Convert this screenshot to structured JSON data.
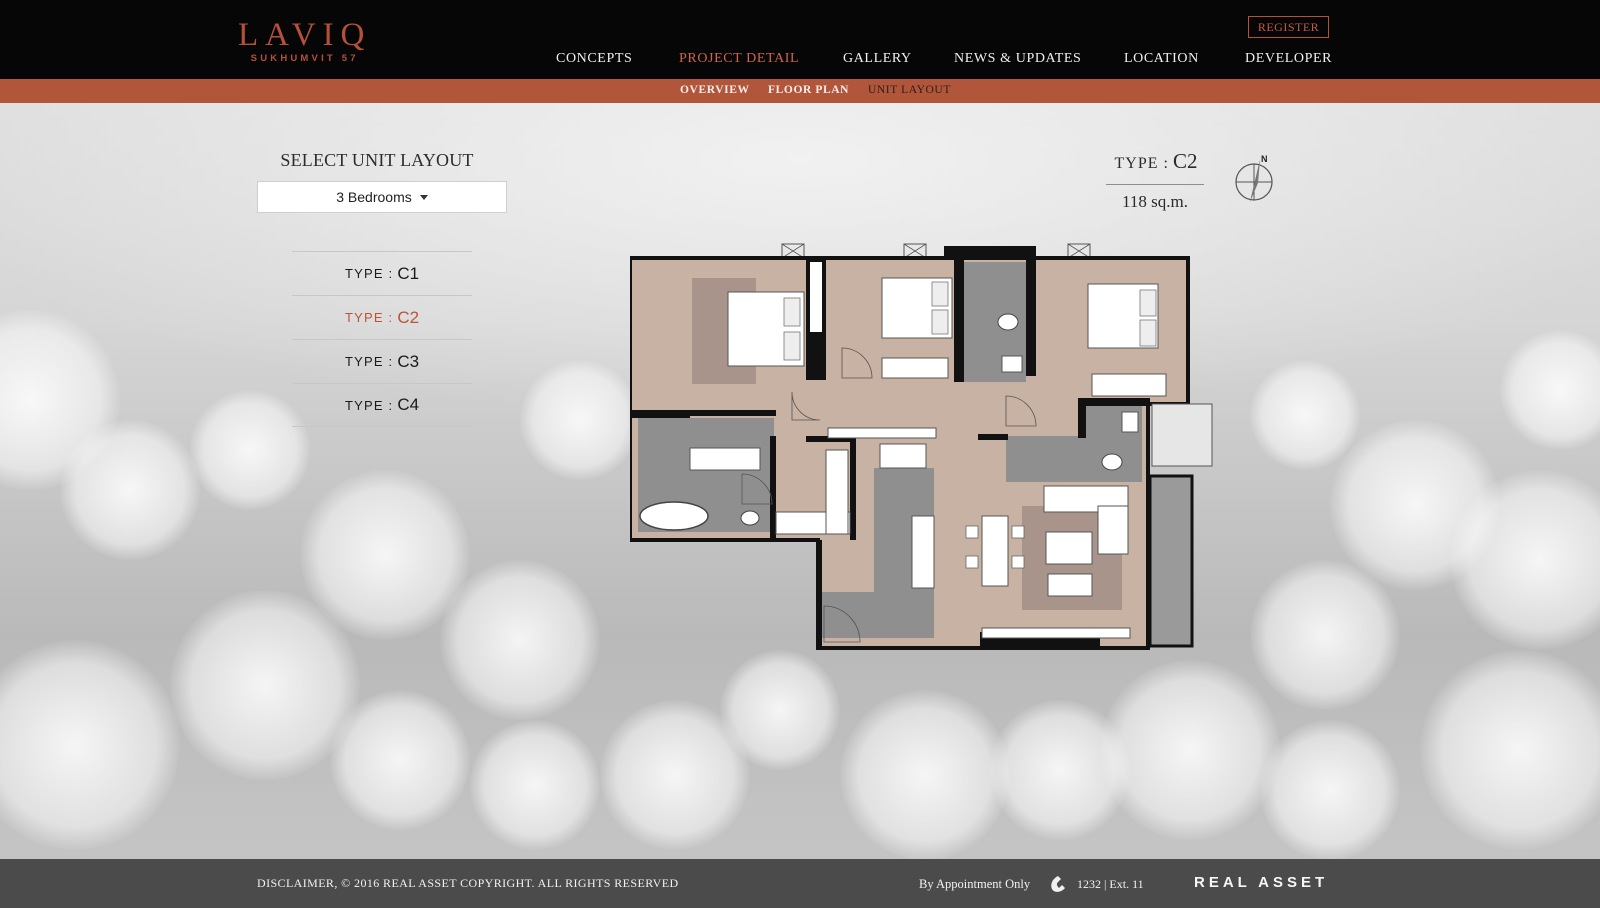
{
  "logo": {
    "main": "LAVIQ",
    "sub": "SUKHUMVIT 57"
  },
  "header": {
    "register_label": "REGISTER"
  },
  "nav": {
    "items": [
      {
        "label": "CONCEPTS"
      },
      {
        "label": "PROJECT DETAIL",
        "active": true
      },
      {
        "label": "GALLERY"
      },
      {
        "label": "NEWS & UPDATES"
      },
      {
        "label": "LOCATION"
      },
      {
        "label": "DEVELOPER"
      }
    ]
  },
  "subnav": {
    "items": [
      {
        "label": "OVERVIEW"
      },
      {
        "label": "FLOOR PLAN"
      },
      {
        "label": "UNIT LAYOUT",
        "active": true
      }
    ]
  },
  "selector": {
    "title": "SELECT UNIT LAYOUT",
    "selected": "3 Bedrooms",
    "types": [
      {
        "label": "TYPE :",
        "value": "C1"
      },
      {
        "label": "TYPE :",
        "value": "C2",
        "active": true
      },
      {
        "label": "TYPE :",
        "value": "C3"
      },
      {
        "label": "TYPE :",
        "value": "C4"
      }
    ]
  },
  "unit": {
    "type_label": "TYPE :",
    "type_value": "C2",
    "area": "118 sq.m."
  },
  "footer": {
    "disclaimer": "DISCLAIMER, © 2016 REAL ASSET COPYRIGHT. ALL RIGHTS RESERVED",
    "appointment": "By Appointment Only",
    "phone": "1232 | Ext. 11",
    "brand": "REAL ASSET"
  },
  "colors": {
    "accent": "#b5503a",
    "header_bg": "#060606",
    "subnav_bg": "#b1563a",
    "footer_bg": "#4b4b4b",
    "room_fill": "#c9b3a4",
    "wet_fill": "#8f8f8f",
    "wall": "#111111"
  },
  "icons": {
    "compass": "compass-icon",
    "phone": "phone-icon",
    "caret": "caret-down-icon"
  }
}
